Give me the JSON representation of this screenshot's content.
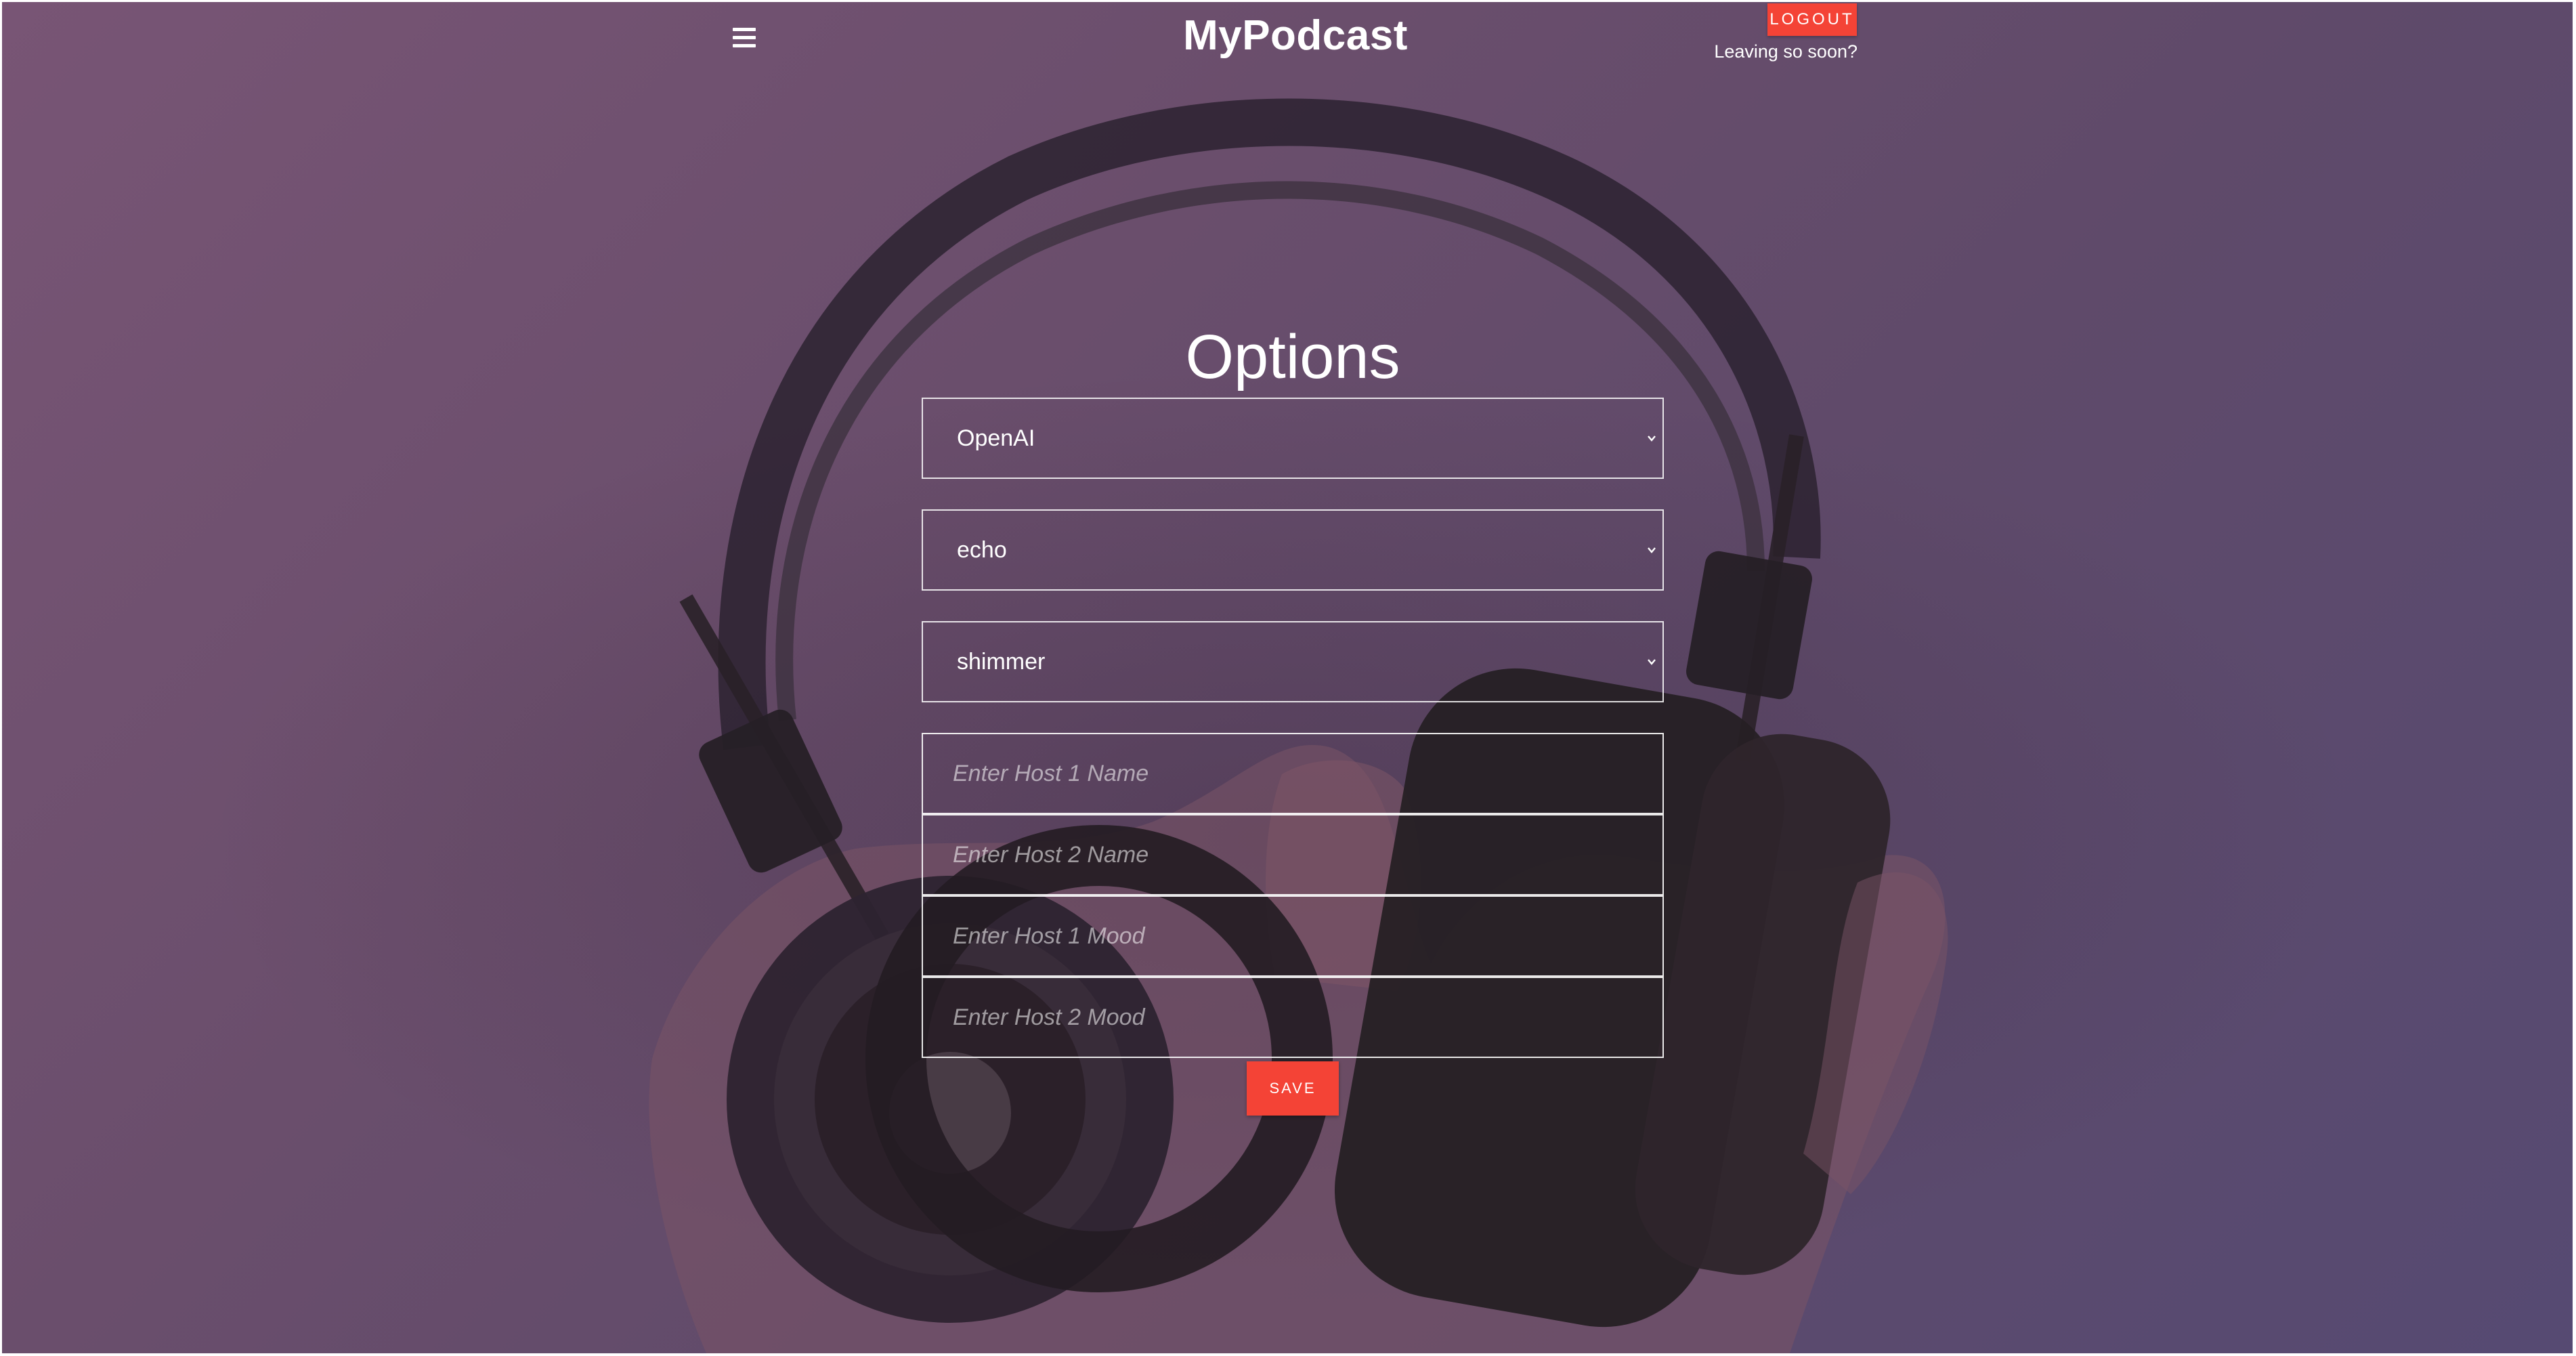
{
  "header": {
    "brand": "MyPodcast",
    "menu_icon": "hamburger-menu-icon",
    "logout_label": "LOGOUT",
    "logout_subtext": "Leaving so soon?"
  },
  "options": {
    "title": "Options",
    "provider": {
      "selected": "OpenAI"
    },
    "voice_1": {
      "selected": "echo"
    },
    "voice_2": {
      "selected": "shimmer"
    },
    "host_1_name": {
      "value": "",
      "placeholder": "Enter Host 1 Name"
    },
    "host_2_name": {
      "value": "",
      "placeholder": "Enter Host 2 Name"
    },
    "host_1_mood": {
      "value": "",
      "placeholder": "Enter Host 1 Mood"
    },
    "host_2_mood": {
      "value": "",
      "placeholder": "Enter Host 2 Mood"
    },
    "save_label": "SAVE"
  },
  "colors": {
    "accent": "#f44336",
    "overlay": "#6a4e6c",
    "text": "#ffffff"
  }
}
